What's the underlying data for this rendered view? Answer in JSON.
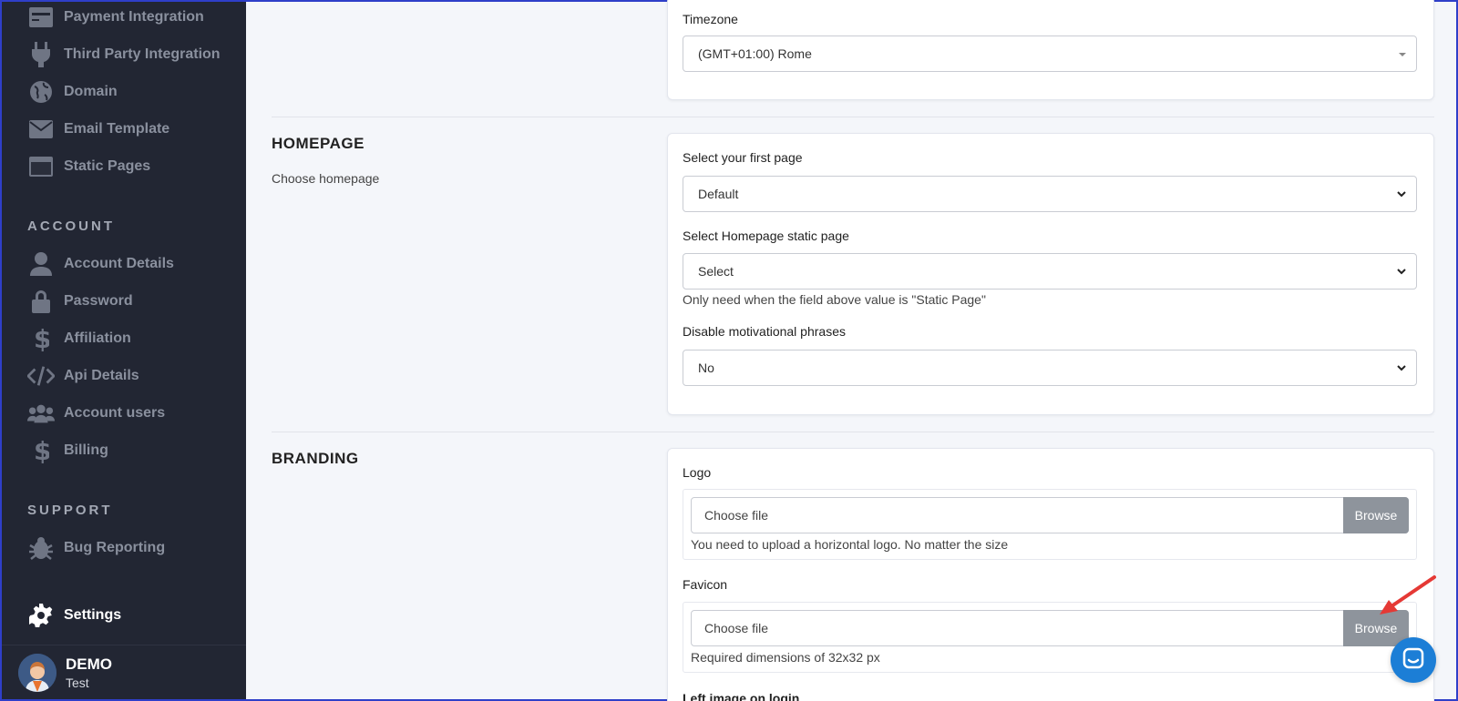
{
  "sidebar": {
    "top_items": [
      {
        "label": "Payment Integration",
        "icon": "credit-card-icon"
      },
      {
        "label": "Third Party Integration",
        "icon": "plug-icon"
      },
      {
        "label": "Domain",
        "icon": "globe-icon"
      },
      {
        "label": "Email Template",
        "icon": "envelope-icon"
      },
      {
        "label": "Static Pages",
        "icon": "window-icon"
      }
    ],
    "account_title": "ACCOUNT",
    "account_items": [
      {
        "label": "Account Details",
        "icon": "user-icon"
      },
      {
        "label": "Password",
        "icon": "lock-icon"
      },
      {
        "label": "Affiliation",
        "icon": "dollar-icon"
      },
      {
        "label": "Api Details",
        "icon": "code-icon"
      },
      {
        "label": "Account users",
        "icon": "users-icon"
      },
      {
        "label": "Billing",
        "icon": "dollar-icon"
      }
    ],
    "support_title": "SUPPORT",
    "support_items": [
      {
        "label": "Bug Reporting",
        "icon": "bug-icon"
      }
    ],
    "active_item": {
      "label": "Settings",
      "icon": "gear-icon"
    },
    "user": {
      "name": "DEMO",
      "subtitle": "Test"
    }
  },
  "general": {
    "timezone_label": "Timezone",
    "timezone_value": "(GMT+01:00) Rome"
  },
  "homepage": {
    "title": "HOMEPAGE",
    "description": "Choose homepage",
    "first_page_label": "Select your first page",
    "first_page_value": "Default",
    "static_page_label": "Select Homepage static page",
    "static_page_value": "Select",
    "static_page_help": "Only need when the field above value is \"Static Page\"",
    "motivational_label": "Disable motivational phrases",
    "motivational_value": "No"
  },
  "branding": {
    "title": "BRANDING",
    "logo_label": "Logo",
    "logo_placeholder": "Choose file",
    "logo_browse": "Browse",
    "logo_help": "You need to upload a horizontal logo. No matter the size",
    "favicon_label": "Favicon",
    "favicon_placeholder": "Choose file",
    "favicon_browse": "Browse",
    "favicon_help": "Required dimensions of 32x32 px",
    "left_image_label": "Left image on login"
  },
  "colors": {
    "sidebar_bg": "#222633",
    "accent": "#1c7ed6",
    "browse_bg": "#8e949c",
    "arrow": "#e53935"
  }
}
